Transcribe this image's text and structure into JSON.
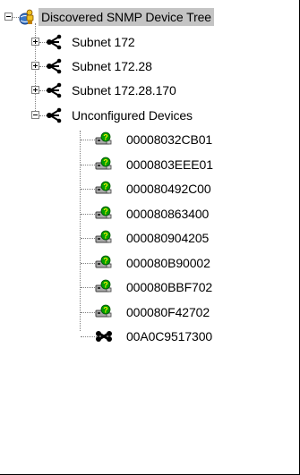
{
  "tree": {
    "root": {
      "label": "Discovered SNMP Device Tree",
      "icon": "globe-person-icon",
      "expanded": true,
      "selected": true
    },
    "subnets": [
      {
        "label": "Subnet 172",
        "icon": "network-icon",
        "expanded": false
      },
      {
        "label": "Subnet 172.28",
        "icon": "network-icon",
        "expanded": false
      },
      {
        "label": "Subnet 172.28.170",
        "icon": "network-icon",
        "expanded": false
      }
    ],
    "unconfigured": {
      "label": "Unconfigured Devices",
      "icon": "network-icon",
      "expanded": true,
      "devices": [
        {
          "label": "00008032CB01",
          "icon": "unknown-device-icon"
        },
        {
          "label": "0000803EEE01",
          "icon": "unknown-device-icon"
        },
        {
          "label": "000080492C00",
          "icon": "unknown-device-icon"
        },
        {
          "label": "000080863400",
          "icon": "unknown-device-icon"
        },
        {
          "label": "000080904205",
          "icon": "unknown-device-icon"
        },
        {
          "label": "000080B90002",
          "icon": "unknown-device-icon"
        },
        {
          "label": "000080BBF702",
          "icon": "unknown-device-icon"
        },
        {
          "label": "000080F42702",
          "icon": "unknown-device-icon"
        },
        {
          "label": "00A0C9517300",
          "icon": "disconnected-device-icon"
        }
      ]
    }
  },
  "colors": {
    "selection": "#c4c4c4",
    "device_green": "#00a000",
    "globe_blue": "#3a78c8",
    "person_yellow": "#f0c020"
  }
}
